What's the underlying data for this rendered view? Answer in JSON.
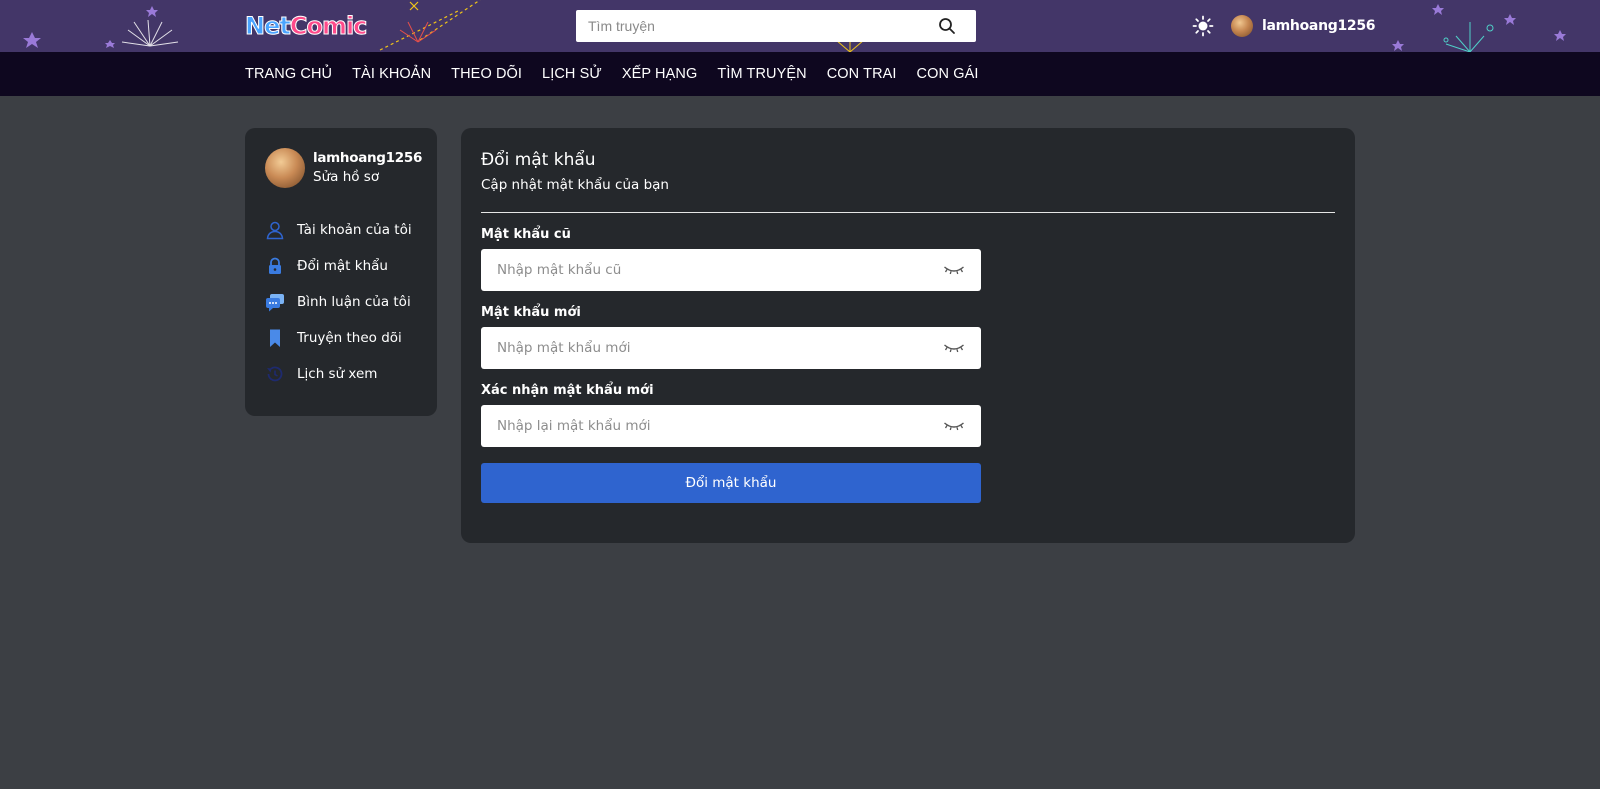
{
  "header": {
    "logo": {
      "part1": "Net",
      "part2": "Comic"
    },
    "search": {
      "placeholder": "Tìm truyện",
      "value": ""
    },
    "username": "lamhoang1256"
  },
  "nav": {
    "items": [
      "TRANG CHỦ",
      "TÀI KHOẢN",
      "THEO DÕI",
      "LỊCH SỬ",
      "XẾP HẠNG",
      "TÌM TRUYỆN",
      "CON TRAI",
      "CON GÁI"
    ]
  },
  "sidebar": {
    "username": "lamhoang1256",
    "edit_profile": "Sửa hồ sơ",
    "items": [
      {
        "label": "Tài khoản của tôi",
        "icon": "user-icon"
      },
      {
        "label": "Đổi mật khẩu",
        "icon": "lock-icon"
      },
      {
        "label": "Bình luận của tôi",
        "icon": "comment-icon"
      },
      {
        "label": "Truyện theo dõi",
        "icon": "bookmark-icon"
      },
      {
        "label": "Lịch sử xem",
        "icon": "history-icon"
      }
    ]
  },
  "form": {
    "title": "Đổi mật khẩu",
    "subtitle": "Cập nhật mật khẩu của bạn",
    "fields": [
      {
        "label": "Mật khẩu cũ",
        "placeholder": "Nhập mật khẩu cũ"
      },
      {
        "label": "Mật khẩu mới",
        "placeholder": "Nhập mật khẩu mới"
      },
      {
        "label": "Xác nhận mật khẩu mới",
        "placeholder": "Nhập lại mật khẩu mới"
      }
    ],
    "submit_label": "Đổi mật khẩu"
  },
  "colors": {
    "header_bg": "#433668",
    "nav_bg": "#0e071f",
    "page_bg": "#3c3f44",
    "card_bg": "#25282c",
    "accent": "#2f64cf"
  }
}
